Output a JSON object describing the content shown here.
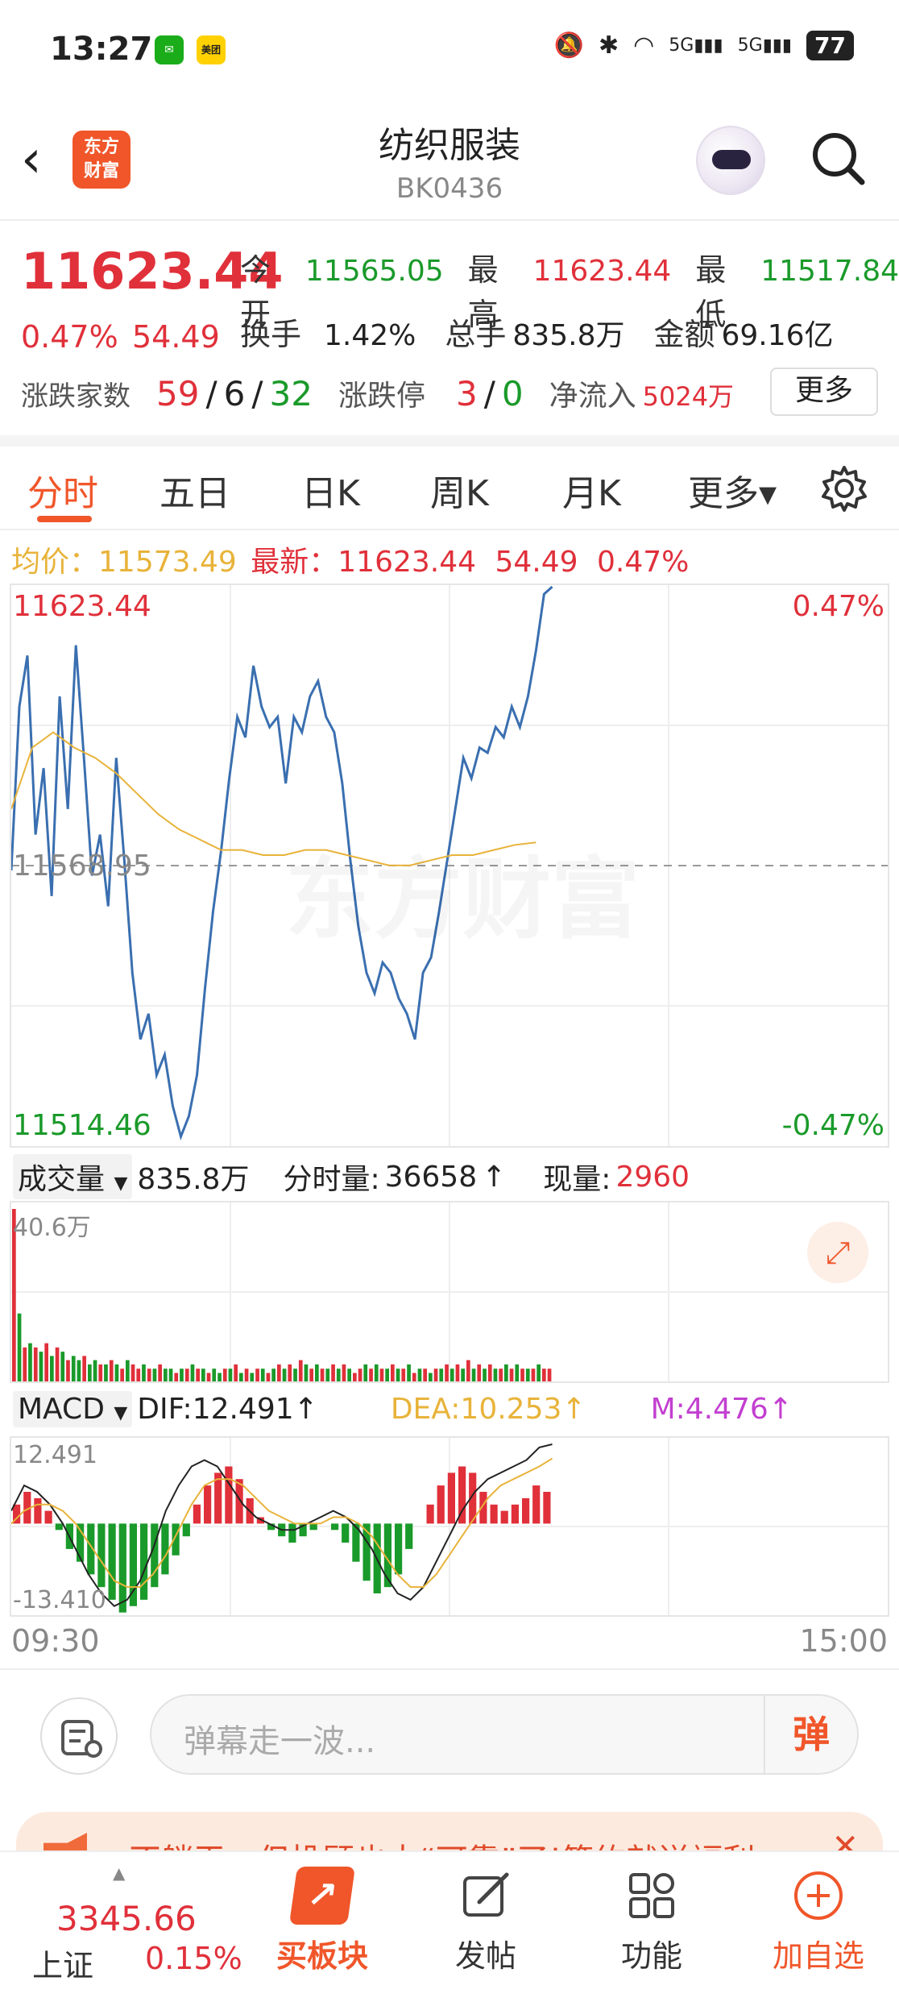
{
  "status_bar": {
    "time": "13:27",
    "apps": [
      {
        "icon": "wechat-icon",
        "label": "",
        "color": "#1aad19"
      },
      {
        "icon": "meituan-icon",
        "label": "美团",
        "color": "#ffd100"
      }
    ],
    "battery": "77"
  },
  "header": {
    "logo_line1": "东方",
    "logo_line2": "财富",
    "title": "纺织服装",
    "code": "BK0436"
  },
  "quote": {
    "price": "11623.44",
    "change_pct": "0.47%",
    "change": "54.49",
    "open_label": "今开",
    "open": "11565.05",
    "high_label": "最高",
    "high": "11623.44",
    "low_label": "最低",
    "low": "11517.84",
    "turnover_label": "换手",
    "turnover": "1.42%",
    "volume_label": "总手",
    "volume": "835.8万",
    "amount_label": "金额",
    "amount": "69.16亿",
    "breadth_label": "涨跌家数",
    "breadth_up": "59",
    "breadth_sep1": "/",
    "breadth_flat": "6",
    "breadth_sep2": "/",
    "breadth_down": "32",
    "limit_label": "涨跌停",
    "limit_up": "3",
    "limit_sep": "/",
    "limit_down": "0",
    "netflow_label": "净流入",
    "netflow": "5024万",
    "more_button": "更多"
  },
  "tabs": [
    "分时",
    "五日",
    "日K",
    "周K",
    "月K",
    "更多▾"
  ],
  "avg_line": {
    "avg_label": "均价：",
    "avg": "11573.49",
    "latest_label": "最新：",
    "latest": "11623.44",
    "latest_change": "54.49",
    "latest_pct": "0.47%"
  },
  "chart_data": [
    {
      "type": "line",
      "title": "",
      "x_start": "09:30",
      "x_end": "15:00",
      "y_max": 11623.44,
      "y_min": 11514.46,
      "y_mid": 11568.95,
      "y_max_label": "11623.44",
      "y_min_label": "11514.46",
      "y_mid_label": "11568.95",
      "pct_max_label": "0.47%",
      "pct_min_label": "-0.47%",
      "series": [
        {
          "role": "price",
          "color": "#3a6fb0",
          "values": [
            11568,
            11600,
            11610,
            11575,
            11588,
            11563,
            11602,
            11580,
            11612,
            11590,
            11567,
            11575,
            11561,
            11590,
            11570,
            11548,
            11535,
            11540,
            11528,
            11532,
            11522,
            11516,
            11520,
            11528,
            11545,
            11560,
            11572,
            11586,
            11598,
            11594,
            11608,
            11600,
            11596,
            11598,
            11585,
            11598,
            11595,
            11602,
            11605,
            11598,
            11595,
            11585,
            11570,
            11557,
            11548,
            11544,
            11550,
            11548,
            11543,
            11540,
            11535,
            11548,
            11551,
            11560,
            11570,
            11580,
            11590,
            11586,
            11592,
            11591,
            11596,
            11594,
            11600,
            11596,
            11602,
            11611,
            11622,
            11623.44
          ]
        },
        {
          "role": "avg",
          "color": "#e8b33a",
          "values": [
            11580,
            11592,
            11595,
            11592,
            11590,
            11587,
            11583,
            11579,
            11576,
            11574,
            11572,
            11572,
            11571,
            11571,
            11572,
            11572,
            11571,
            11570,
            11569,
            11569,
            11570,
            11571,
            11571,
            11572,
            11573,
            11573.49
          ]
        }
      ]
    },
    {
      "type": "bar",
      "title": "成交量",
      "total": "835.8万",
      "minute_label": "分时量:",
      "minute_volume": "36658",
      "current_label": "现量:",
      "current_volume": "2960",
      "ymax_label": "40.6万",
      "values": [
        40.6,
        16,
        8,
        9,
        8,
        7,
        9,
        6,
        8,
        7,
        5,
        6,
        5,
        6,
        4,
        5,
        4,
        4,
        5,
        4,
        3,
        5,
        4,
        3,
        4,
        3,
        3,
        4,
        3,
        3,
        2,
        3,
        3,
        4,
        3,
        3,
        2,
        3,
        2,
        3,
        3,
        4,
        2,
        3,
        2,
        3,
        3,
        2,
        3,
        4,
        3,
        4,
        3,
        5,
        4,
        3,
        4,
        3,
        3,
        4,
        3,
        4,
        3,
        2,
        3,
        4,
        3,
        4,
        3,
        3,
        4,
        3,
        3,
        4,
        2,
        3,
        3,
        2,
        3,
        3,
        4,
        3,
        4,
        3,
        5,
        3,
        4,
        3,
        4,
        3,
        3,
        4,
        3,
        4,
        3,
        3,
        3,
        4,
        3,
        3
      ],
      "colors": [
        "r",
        "g",
        "r",
        "g",
        "r",
        "g",
        "r",
        "g",
        "r",
        "g",
        "r",
        "g",
        "g",
        "r",
        "g",
        "g",
        "r",
        "g",
        "r",
        "g",
        "r",
        "g",
        "r",
        "r",
        "g",
        "r",
        "g",
        "r",
        "g",
        "g",
        "r",
        "g",
        "r",
        "g",
        "r",
        "g",
        "r",
        "g",
        "g",
        "r",
        "g",
        "r",
        "g",
        "r",
        "g",
        "r",
        "g",
        "r",
        "g",
        "r",
        "g",
        "r",
        "g",
        "r",
        "g",
        "r",
        "g",
        "r",
        "g",
        "r",
        "g",
        "r",
        "g",
        "r",
        "r",
        "g",
        "r",
        "g",
        "r",
        "g",
        "r",
        "g",
        "r",
        "g",
        "r",
        "g",
        "r",
        "g",
        "r",
        "g",
        "r",
        "g",
        "r",
        "g",
        "r",
        "g",
        "r",
        "g",
        "r",
        "g",
        "r",
        "g",
        "r",
        "g",
        "r",
        "g",
        "r",
        "g",
        "r",
        "r"
      ]
    },
    {
      "type": "bar",
      "title": "MACD",
      "dif_label": "DIF:",
      "dif": "12.491↑",
      "dea_label": "DEA:",
      "dea": "10.253↑",
      "m_label": "M:",
      "m": "4.476↑",
      "ymax_label": "12.491",
      "ymin_label": "-13.410",
      "hist": [
        3,
        5,
        4,
        2,
        -1,
        -4,
        -6,
        -8,
        -10,
        -12,
        -14,
        -13,
        -12,
        -10,
        -8,
        -5,
        -2,
        3,
        6,
        8,
        9,
        7,
        4,
        1,
        -1,
        -2,
        -3,
        -2,
        -1,
        0,
        -1,
        -3,
        -6,
        -9,
        -11,
        -10,
        -8,
        -4,
        0,
        3,
        6,
        8,
        9,
        8,
        5,
        3,
        2,
        3,
        4,
        6,
        5
      ],
      "dif_line": [
        2,
        6,
        5,
        3,
        0,
        -4,
        -8,
        -11,
        -13,
        -12,
        -9,
        -4,
        2,
        6,
        9,
        10,
        9,
        6,
        3,
        1,
        0,
        -1,
        -1,
        0,
        1,
        2,
        1,
        -1,
        -4,
        -8,
        -11,
        -12,
        -10,
        -6,
        -2,
        2,
        5,
        7,
        8,
        9,
        10,
        12,
        12.491
      ],
      "dea_line": [
        0,
        2,
        3,
        3,
        2,
        0,
        -3,
        -6,
        -9,
        -10,
        -10,
        -8,
        -5,
        -1,
        3,
        6,
        7,
        7,
        6,
        4,
        2,
        1,
        0,
        0,
        0,
        1,
        1,
        0,
        -2,
        -5,
        -8,
        -10,
        -10,
        -8,
        -5,
        -2,
        1,
        4,
        6,
        7,
        8,
        9,
        10.253
      ]
    }
  ],
  "chart_axis": {
    "start": "09:30",
    "end": "15:00",
    "watermark": "东方财富"
  },
  "danmu": {
    "placeholder": "弹幕走一波...",
    "button": "弹"
  },
  "ad": {
    "text": "不躺平，但投顾也太“可靠”了!签约就送福利"
  },
  "bottom_bar": {
    "index_value": "3345.66",
    "index_name": "上证",
    "index_pct": "0.15%",
    "items": [
      {
        "label": "买板块",
        "icon": "buy-sector-icon"
      },
      {
        "label": "发帖",
        "icon": "edit-post-icon"
      },
      {
        "label": "功能",
        "icon": "grid-functions-icon"
      },
      {
        "label": "加自选",
        "icon": "add-watchlist-icon"
      }
    ]
  },
  "colors": {
    "up": "#e0303a",
    "down": "#1a9a2a",
    "accent": "#f0562a",
    "price_line": "#3a6fb0",
    "avg_line": "#e8b33a",
    "macd_m": "#c23fd0"
  }
}
